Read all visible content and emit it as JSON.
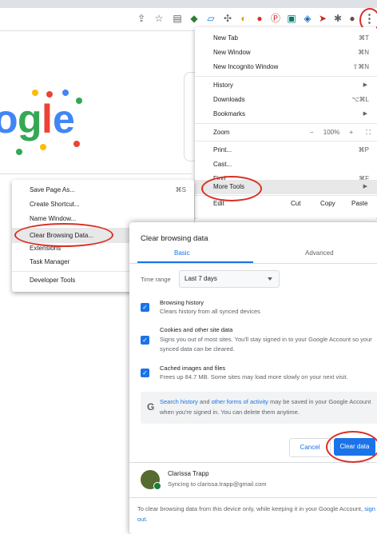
{
  "toolbar": {
    "icons": [
      "share-icon",
      "star-icon",
      "reader-icon",
      "evernote-icon",
      "extension-icon",
      "extension-icon",
      "extension-icon",
      "extension-icon",
      "extension-icon",
      "pinterest-icon",
      "extension-icon",
      "extension-icon",
      "extension-icon",
      "puzzle-icon",
      "profile-icon",
      "menu-kebab-icon"
    ]
  },
  "menu": {
    "new_tab": "New Tab",
    "new_tab_sc": "⌘T",
    "new_window": "New Window",
    "new_window_sc": "⌘N",
    "incognito": "New Incognito Window",
    "incognito_sc": "⇧⌘N",
    "history": "History",
    "downloads": "Downloads",
    "downloads_sc": "⌥⌘L",
    "bookmarks": "Bookmarks",
    "zoom": "Zoom",
    "zoom_minus": "−",
    "zoom_value": "100%",
    "zoom_plus": "+",
    "print": "Print...",
    "print_sc": "⌘P",
    "cast": "Cast...",
    "find": "Find...",
    "find_sc": "⌘F",
    "more_tools": "More Tools",
    "edit": "Edit",
    "cut": "Cut",
    "copy": "Copy",
    "paste": "Paste"
  },
  "submenu": {
    "save_page": "Save Page As...",
    "save_page_sc": "⌘S",
    "create_shortcut": "Create Shortcut...",
    "name_window": "Name Window...",
    "clear_browsing": "Clear Browsing Data...",
    "clear_browsing_sc": "⇧⌘⌫",
    "extensions": "Extensions",
    "task_manager": "Task Manager",
    "developer_tools": "Developer Tools"
  },
  "dialog": {
    "title": "Clear browsing data",
    "tab_basic": "Basic",
    "tab_advanced": "Advanced",
    "time_range_label": "Time range",
    "time_range_value": "Last 7 days",
    "history_title": "Browsing history",
    "history_desc": "Clears history from all synced devices",
    "cookies_title": "Cookies and other site data",
    "cookies_desc": "Signs you out of most sites. You'll stay signed in to your Google Account so your synced data can be cleared.",
    "cache_title": "Cached images and files",
    "cache_desc": "Frees up 84.7 MB. Some sites may load more slowly on your next visit.",
    "info_link1": "Search history",
    "info_and": " and ",
    "info_link2": "other forms of activity",
    "info_rest": " may be saved in your Google Account when you're signed in. You can delete them anytime.",
    "cancel": "Cancel",
    "clear": "Clear data",
    "user_name": "Clarissa Trapp",
    "user_sync": "Syncing to clarissa.trapp@gmail.com",
    "footer_text": "To clear browsing data from this device only, while keeping it in your Google Account, ",
    "footer_link": "sign out",
    "footer_end": "."
  },
  "colors": {
    "accent": "#1a73e8",
    "annotation": "#d93025"
  }
}
